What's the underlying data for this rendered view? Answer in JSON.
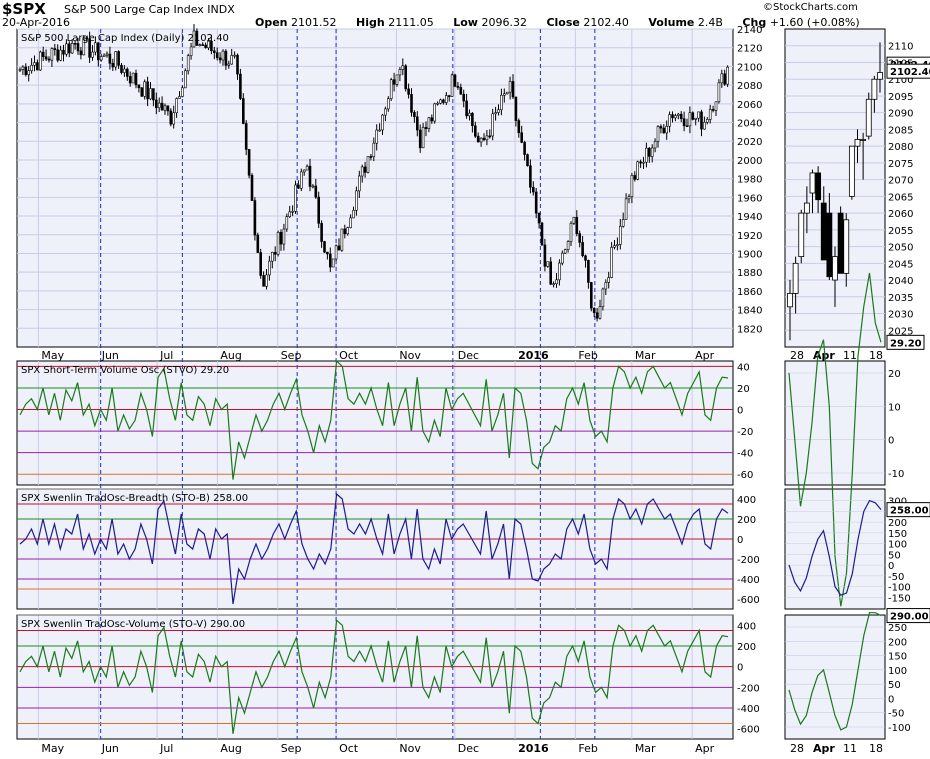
{
  "header": {
    "symbol": "$SPX",
    "name": "S&P 500 Large Cap Index  INDX",
    "date": "20-Apr-2016",
    "open_label": "Open",
    "open": "2101.52",
    "high_label": "High",
    "high": "2111.05",
    "low_label": "Low",
    "low": "2096.32",
    "close_label": "Close",
    "close": "2102.40",
    "volume_label": "Volume",
    "volume": "2.4B",
    "chg_label": "Chg",
    "chg": "+1.60 (+0.08%)",
    "credit": "StockCharts.com"
  },
  "colors": {
    "panel_bg": "#eef0fa",
    "grid": "#c9cde4",
    "price": "#000000",
    "stvo": "#1a7a1a",
    "sto_b": "#1d1d8c",
    "sto_v": "#1a7a1a",
    "event_line": "#1e2bcc",
    "level_red": "#c8102e",
    "level_green": "#1e8a1e",
    "level_purple": "#9b1fa8",
    "level_orange": "#e0702a"
  },
  "chart_data": [
    {
      "type": "candlestick",
      "panel": "price",
      "title": "S&P 500 Large Cap Index (Daily) 2102.40",
      "ylim": [
        1800,
        2140
      ],
      "yticks": [
        "1820",
        "1840",
        "1860",
        "1880",
        "1900",
        "1920",
        "1940",
        "1960",
        "1980",
        "2000",
        "2020",
        "2040",
        "2060",
        "2080",
        "2100",
        "2120",
        "2140"
      ],
      "x_labels": [
        "May",
        "Jun",
        "Jul",
        "Aug",
        "Sep",
        "Oct",
        "Nov",
        "Dec",
        "2016",
        "Feb",
        "Mar",
        "Apr"
      ],
      "last_value": "2102.40",
      "key_points": [
        {
          "date": "2015-04-22",
          "close": 2097
        },
        {
          "date": "2015-05-20",
          "close": 2125
        },
        {
          "date": "2015-06-10",
          "close": 2105
        },
        {
          "date": "2015-07-08",
          "close": 2046
        },
        {
          "date": "2015-07-20",
          "close": 2128
        },
        {
          "date": "2015-08-10",
          "close": 2104
        },
        {
          "date": "2015-08-24",
          "close": 1867
        },
        {
          "date": "2015-09-16",
          "close": 1995
        },
        {
          "date": "2015-09-28",
          "close": 1881
        },
        {
          "date": "2015-11-03",
          "close": 2109
        },
        {
          "date": "2015-11-13",
          "close": 2023
        },
        {
          "date": "2015-12-02",
          "close": 2091
        },
        {
          "date": "2015-12-14",
          "close": 2012
        },
        {
          "date": "2015-12-29",
          "close": 2078
        },
        {
          "date": "2016-01-20",
          "close": 1859
        },
        {
          "date": "2016-02-01",
          "close": 1939
        },
        {
          "date": "2016-02-11",
          "close": 1829
        },
        {
          "date": "2016-03-01",
          "close": 1978
        },
        {
          "date": "2016-03-21",
          "close": 2051
        },
        {
          "date": "2016-04-07",
          "close": 2041
        },
        {
          "date": "2016-04-20",
          "close": 2102
        }
      ],
      "event_lines": [
        "2015-06-02",
        "2015-07-14",
        "2015-09-11",
        "2015-10-01",
        "2015-11-30",
        "2016-01-14",
        "2016-02-11"
      ]
    },
    {
      "type": "candlestick",
      "panel": "price-zoom",
      "ylim": [
        2020,
        2115
      ],
      "yticks": [
        "2025",
        "2030",
        "2035",
        "2040",
        "2045",
        "2050",
        "2055",
        "2060",
        "2065",
        "2070",
        "2075",
        "2080",
        "2085",
        "2090",
        "2095",
        "2100",
        "2105",
        "2110"
      ],
      "x_labels": [
        "28",
        "Apr",
        "11",
        "18"
      ],
      "last_value": "2102.40",
      "candles": [
        {
          "o": 2032,
          "h": 2040,
          "l": 2022,
          "c": 2036
        },
        {
          "o": 2036,
          "h": 2047,
          "l": 2030,
          "c": 2045
        },
        {
          "o": 2047,
          "h": 2061,
          "l": 2045,
          "c": 2060
        },
        {
          "o": 2060,
          "h": 2068,
          "l": 2054,
          "c": 2063
        },
        {
          "o": 2066,
          "h": 2073,
          "l": 2060,
          "c": 2072
        },
        {
          "o": 2072,
          "h": 2074,
          "l": 2060,
          "c": 2064
        },
        {
          "o": 2063,
          "h": 2068,
          "l": 2047,
          "c": 2046
        },
        {
          "o": 2060,
          "h": 2066,
          "l": 2040,
          "c": 2041
        },
        {
          "o": 2040,
          "h": 2050,
          "l": 2032,
          "c": 2047
        },
        {
          "o": 2060,
          "h": 2062,
          "l": 2042,
          "c": 2042
        },
        {
          "o": 2042,
          "h": 2060,
          "l": 2038,
          "c": 2058
        },
        {
          "o": 2065,
          "h": 2080,
          "l": 2064,
          "c": 2080
        },
        {
          "o": 2080,
          "h": 2085,
          "l": 2075,
          "c": 2082
        },
        {
          "o": 2082,
          "h": 2084,
          "l": 2070,
          "c": 2082
        },
        {
          "o": 2083,
          "h": 2096,
          "l": 2082,
          "c": 2094
        },
        {
          "o": 2094,
          "h": 2101,
          "l": 2090,
          "c": 2100
        },
        {
          "o": 2100,
          "h": 2111,
          "l": 2096,
          "c": 2102
        }
      ]
    },
    {
      "type": "line",
      "panel": "stvo",
      "title": "SPX Short-Term Volume Osc (STVO) 29.20",
      "ylim": [
        -70,
        45
      ],
      "yticks": [
        "-60",
        "-40",
        "-20",
        "0",
        "20",
        "40"
      ],
      "levels": [
        {
          "y": 40,
          "color": "red"
        },
        {
          "y": 20,
          "color": "green"
        },
        {
          "y": 0,
          "color": "red"
        },
        {
          "y": -20,
          "color": "purple"
        },
        {
          "y": -40,
          "color": "purple"
        },
        {
          "y": -60,
          "color": "orange"
        }
      ],
      "last_value": "29.20",
      "series": [
        {
          "name": "STVO",
          "values": [
            -5,
            5,
            10,
            0,
            20,
            -5,
            15,
            -10,
            18,
            8,
            25,
            -5,
            5,
            -15,
            0,
            -10,
            20,
            -20,
            -5,
            -18,
            -10,
            15,
            0,
            -25,
            30,
            38,
            10,
            -10,
            25,
            -5,
            -10,
            12,
            5,
            -15,
            10,
            0,
            5,
            -65,
            -30,
            -45,
            -25,
            -5,
            -20,
            -10,
            5,
            15,
            0,
            15,
            28,
            -5,
            -20,
            -40,
            -15,
            -30,
            -10,
            45,
            40,
            10,
            5,
            15,
            5,
            20,
            0,
            -15,
            25,
            -15,
            5,
            20,
            -20,
            30,
            -20,
            -30,
            -10,
            -25,
            20,
            0,
            10,
            15,
            5,
            -5,
            -15,
            28,
            -20,
            -5,
            15,
            -45,
            20,
            15,
            -10,
            -50,
            -55,
            -35,
            -30,
            -15,
            -20,
            10,
            20,
            5,
            25,
            -10,
            -25,
            -20,
            -30,
            20,
            40,
            35,
            20,
            30,
            15,
            35,
            40,
            30,
            20,
            25,
            10,
            -5,
            15,
            25,
            35,
            -5,
            -10,
            20,
            30,
            29.2
          ]
        }
      ]
    },
    {
      "type": "line",
      "panel": "sto_b",
      "title": "SPX Swenlin TradOsc-Breadth (STO-B) 258.00",
      "ylim": [
        -700,
        500
      ],
      "yticks": [
        "-600",
        "-400",
        "-200",
        "0",
        "200",
        "400"
      ],
      "levels": [
        {
          "y": 500,
          "color": "gray"
        },
        {
          "y": 350,
          "color": "red"
        },
        {
          "y": 200,
          "color": "green"
        },
        {
          "y": 0,
          "color": "red"
        },
        {
          "y": -200,
          "color": "purple"
        },
        {
          "y": -400,
          "color": "purple"
        },
        {
          "y": -500,
          "color": "orange"
        }
      ],
      "last_value": "258.00",
      "series": [
        {
          "name": "STO-B",
          "values": [
            -50,
            0,
            100,
            -50,
            200,
            -50,
            150,
            -100,
            100,
            50,
            250,
            -100,
            50,
            -150,
            0,
            -100,
            200,
            -150,
            -50,
            -200,
            -100,
            150,
            0,
            -250,
            300,
            380,
            100,
            -150,
            250,
            -50,
            -100,
            100,
            50,
            -200,
            100,
            0,
            50,
            -650,
            -300,
            -400,
            -200,
            -50,
            -200,
            -100,
            50,
            150,
            0,
            150,
            280,
            -50,
            -200,
            -300,
            -150,
            -250,
            -100,
            450,
            400,
            100,
            50,
            150,
            50,
            200,
            0,
            -150,
            250,
            -150,
            50,
            200,
            -200,
            300,
            -200,
            -300,
            -100,
            -250,
            200,
            0,
            100,
            150,
            50,
            -50,
            -150,
            280,
            -200,
            -50,
            150,
            -400,
            200,
            150,
            -100,
            -400,
            -420,
            -300,
            -250,
            -150,
            -200,
            100,
            200,
            50,
            250,
            -100,
            -250,
            -200,
            -300,
            200,
            400,
            350,
            200,
            300,
            150,
            350,
            400,
            300,
            200,
            250,
            100,
            -50,
            150,
            250,
            300,
            -50,
            -100,
            200,
            300,
            258
          ]
        }
      ]
    },
    {
      "type": "line",
      "panel": "sto_v",
      "title": "SPX Swenlin TradOsc-Volume (STO-V) 290.00",
      "ylim": [
        -700,
        500
      ],
      "yticks": [
        "-600",
        "-400",
        "-200",
        "0",
        "200",
        "400"
      ],
      "levels": [
        {
          "y": 500,
          "color": "gray"
        },
        {
          "y": 350,
          "color": "red"
        },
        {
          "y": 200,
          "color": "green"
        },
        {
          "y": 0,
          "color": "red"
        },
        {
          "y": -200,
          "color": "purple"
        },
        {
          "y": -400,
          "color": "purple"
        },
        {
          "y": -550,
          "color": "orange"
        }
      ],
      "last_value": "290.00",
      "series": [
        {
          "name": "STO-V",
          "values": [
            -50,
            50,
            100,
            0,
            200,
            -50,
            150,
            -100,
            180,
            80,
            250,
            -50,
            50,
            -150,
            0,
            -100,
            200,
            -200,
            -50,
            -180,
            -100,
            150,
            0,
            -250,
            300,
            380,
            100,
            -100,
            250,
            -50,
            -100,
            120,
            50,
            -150,
            100,
            0,
            50,
            -650,
            -300,
            -450,
            -250,
            -50,
            -200,
            -100,
            50,
            150,
            0,
            150,
            280,
            -50,
            -200,
            -400,
            -150,
            -300,
            -100,
            450,
            400,
            100,
            50,
            150,
            50,
            200,
            0,
            -150,
            250,
            -150,
            50,
            200,
            -200,
            300,
            -200,
            -300,
            -100,
            -250,
            200,
            0,
            100,
            150,
            50,
            -50,
            -150,
            280,
            -200,
            -50,
            150,
            -450,
            200,
            150,
            -100,
            -500,
            -550,
            -350,
            -300,
            -150,
            -200,
            100,
            200,
            50,
            250,
            -100,
            -250,
            -200,
            -300,
            200,
            400,
            350,
            200,
            300,
            150,
            350,
            400,
            300,
            200,
            250,
            100,
            -50,
            150,
            250,
            350,
            -50,
            -100,
            200,
            300,
            290
          ]
        }
      ]
    },
    {
      "type": "line",
      "panel": "stvo-zoom",
      "yticks": [
        "-10",
        "0",
        "10",
        "20"
      ],
      "series": [
        {
          "name": "STVO",
          "values": [
            20,
            0,
            -20,
            -10,
            5,
            25,
            30,
            10,
            -35,
            -50,
            -40,
            -10,
            25,
            40,
            50,
            35,
            29.2
          ]
        }
      ],
      "last_value": "29.20"
    },
    {
      "type": "line",
      "panel": "sto_b-zoom",
      "yticks": [
        "-150",
        "-100",
        "-50",
        "0",
        "50",
        "100",
        "150",
        "200",
        "250",
        "300"
      ],
      "series": [
        {
          "name": "STO-B",
          "values": [
            0,
            -80,
            -120,
            -60,
            40,
            120,
            160,
            40,
            -100,
            -140,
            -130,
            -40,
            120,
            250,
            300,
            290,
            258
          ]
        }
      ],
      "last_value": "258.00"
    },
    {
      "type": "line",
      "panel": "sto_v-zoom",
      "yticks": [
        "-100",
        "-50",
        "0",
        "50",
        "100",
        "150",
        "200",
        "250"
      ],
      "series": [
        {
          "name": "STO-V",
          "values": [
            30,
            -40,
            -90,
            -60,
            20,
            80,
            100,
            20,
            -60,
            -110,
            -100,
            -20,
            100,
            220,
            300,
            300,
            290
          ]
        }
      ],
      "last_value": "290.00"
    }
  ]
}
